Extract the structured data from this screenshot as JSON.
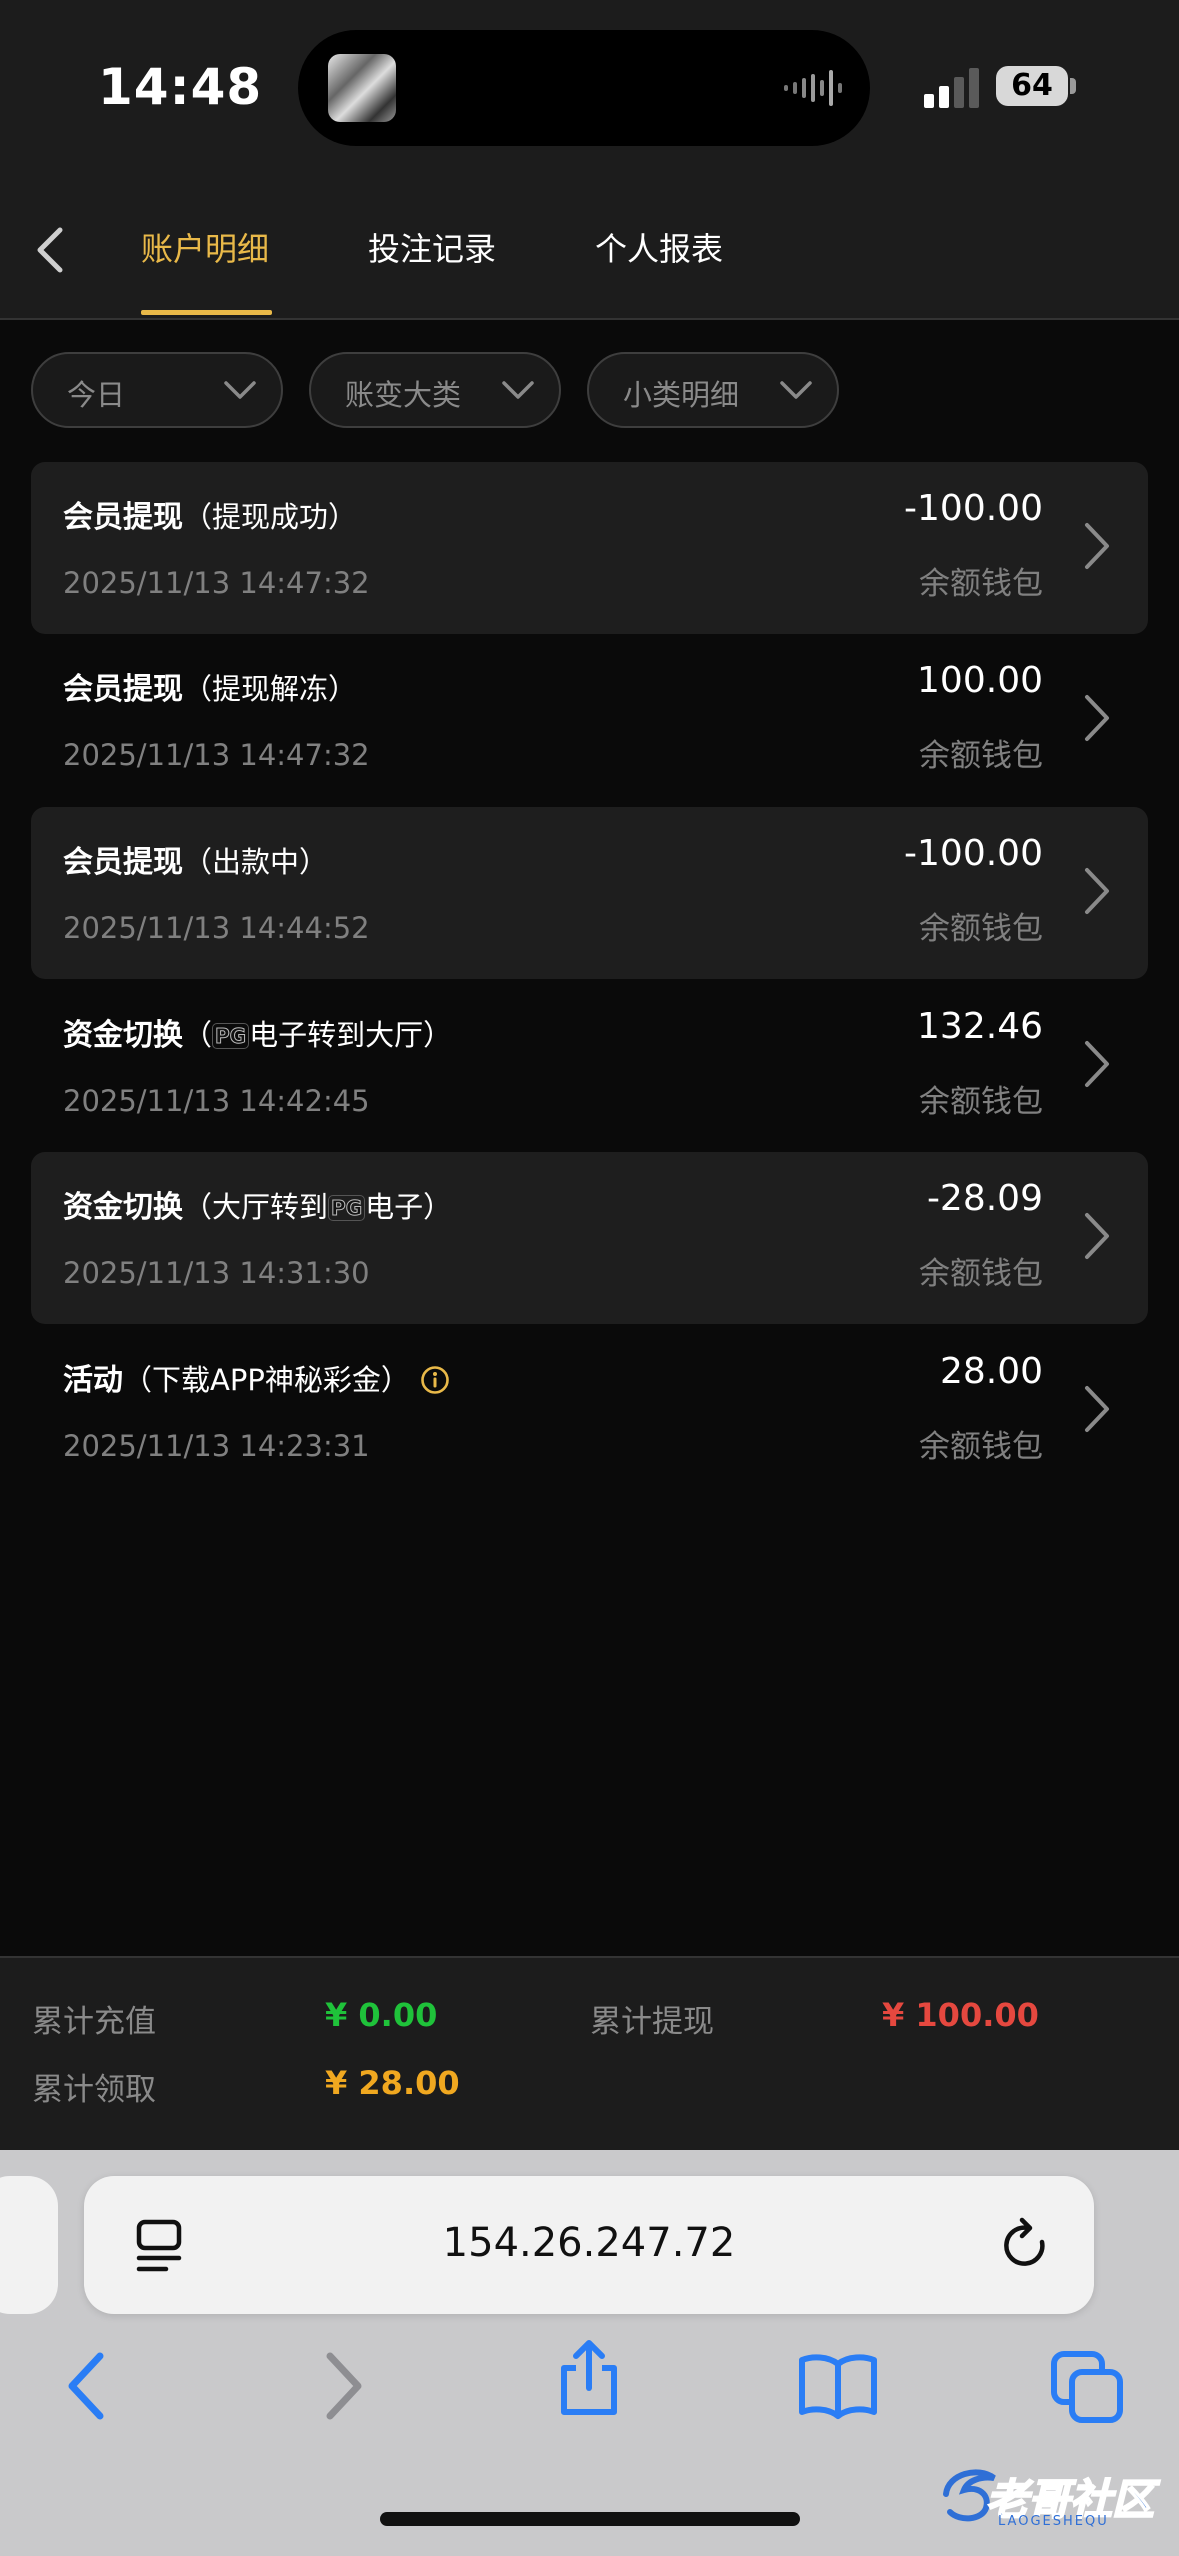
{
  "status": {
    "time": "14:48",
    "battery": "64"
  },
  "nav": {
    "tabs": [
      {
        "label": "账户明细",
        "active": true
      },
      {
        "label": "投注记录",
        "active": false
      },
      {
        "label": "个人报表",
        "active": false
      }
    ]
  },
  "filters": [
    {
      "label": "今日"
    },
    {
      "label": "账变大类"
    },
    {
      "label": "小类明细"
    }
  ],
  "records": [
    {
      "main": "会员提现",
      "sub_open": "（",
      "sub_pre": "提现成功",
      "pg": "",
      "sub_post": "",
      "sub_close": "）",
      "date": "2025/11/13 14:47:32",
      "amount": "-100.00",
      "wallet": "余额钱包"
    },
    {
      "main": "会员提现",
      "sub_open": "（",
      "sub_pre": "提现解冻",
      "pg": "",
      "sub_post": "",
      "sub_close": "）",
      "date": "2025/11/13 14:47:32",
      "amount": "100.00",
      "wallet": "余额钱包"
    },
    {
      "main": "会员提现",
      "sub_open": "（",
      "sub_pre": "出款中",
      "pg": "",
      "sub_post": "",
      "sub_close": "）",
      "date": "2025/11/13 14:44:52",
      "amount": "-100.00",
      "wallet": "余额钱包"
    },
    {
      "main": "资金切换",
      "sub_open": "（",
      "sub_pre": "",
      "pg": "PG",
      "sub_post": "电子转到大厅",
      "sub_close": "）",
      "date": "2025/11/13 14:42:45",
      "amount": "132.46",
      "wallet": "余额钱包"
    },
    {
      "main": "资金切换",
      "sub_open": "（",
      "sub_pre": "大厅转到",
      "pg": "PG",
      "sub_post": "电子",
      "sub_close": "）",
      "date": "2025/11/13 14:31:30",
      "amount": "-28.09",
      "wallet": "余额钱包"
    },
    {
      "main": "活动",
      "sub_open": "（",
      "sub_pre": "下载APP神秘彩金",
      "pg": "",
      "sub_post": "",
      "sub_close": "）",
      "date": "2025/11/13 14:23:31",
      "amount": "28.00",
      "wallet": "余额钱包"
    }
  ],
  "summary": {
    "recharge_label": "累计充值",
    "recharge_value": "¥ 0.00",
    "withdraw_label": "累计提现",
    "withdraw_value": "¥ 100.00",
    "claim_label": "累计领取",
    "claim_value": "¥ 28.00"
  },
  "browser": {
    "url": "154.26.247.72"
  },
  "colors": {
    "accent": "#e9b949",
    "positive": "#1fc23a",
    "negative": "#e5483f",
    "gold": "#f0a820"
  },
  "watermark": {
    "text": "老哥社区",
    "subtext": "LAOGESHEQU"
  }
}
